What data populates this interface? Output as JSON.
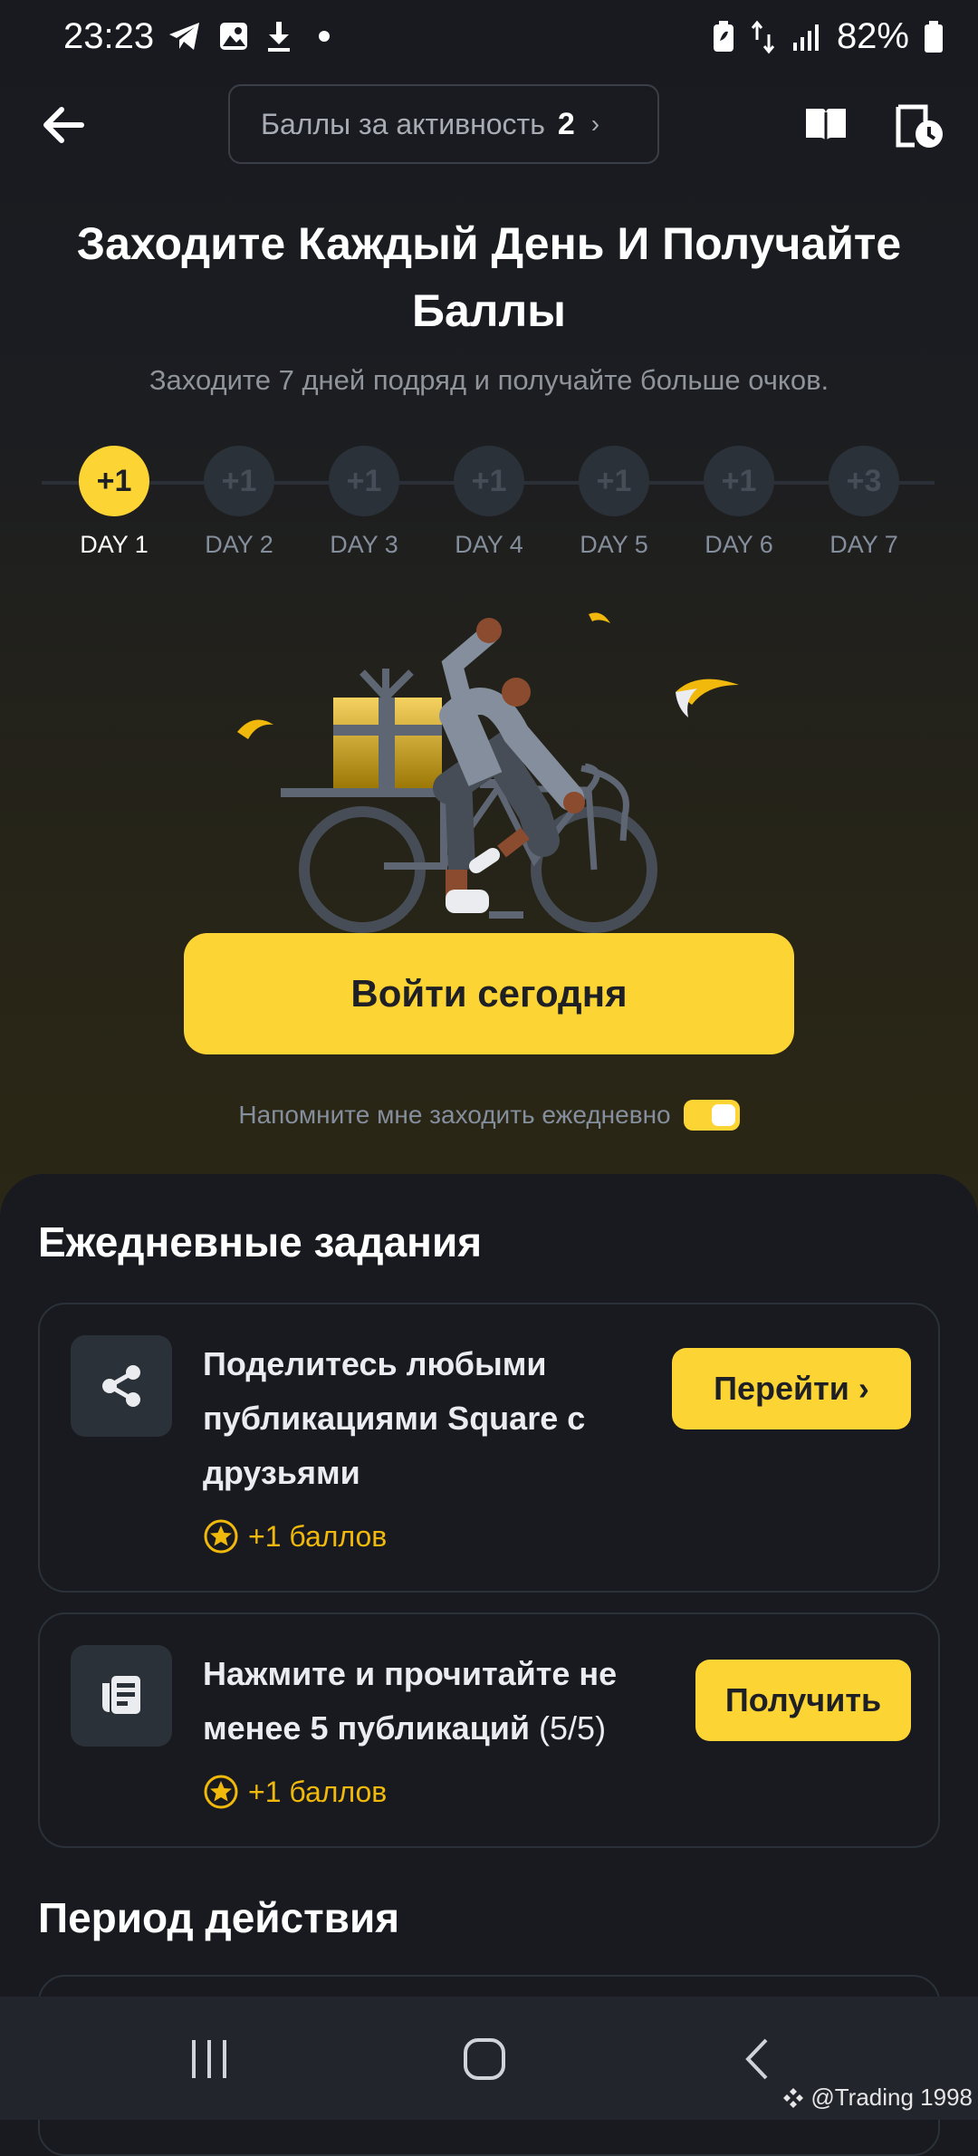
{
  "status_bar": {
    "time": "23:23",
    "battery": "82%",
    "icons": [
      "telegram-icon",
      "image-icon",
      "download-icon",
      "dot-icon",
      "battery-saver-icon",
      "data-arrows-icon",
      "signal-icon",
      "battery-icon"
    ]
  },
  "header": {
    "points_label": "Баллы за активность",
    "points_value": "2",
    "points_chevron": "›"
  },
  "hero": {
    "title": "Заходите Каждый День И Получайте Баллы",
    "subtitle": "Заходите 7 дней подряд и получайте больше очков."
  },
  "days": [
    {
      "reward": "+1",
      "label": "DAY 1",
      "active": true
    },
    {
      "reward": "+1",
      "label": "DAY 2",
      "active": false
    },
    {
      "reward": "+1",
      "label": "DAY 3",
      "active": false
    },
    {
      "reward": "+1",
      "label": "DAY 4",
      "active": false
    },
    {
      "reward": "+1",
      "label": "DAY 5",
      "active": false
    },
    {
      "reward": "+1",
      "label": "DAY 6",
      "active": false
    },
    {
      "reward": "+3",
      "label": "DAY 7",
      "active": false
    }
  ],
  "checkin": {
    "button_label": "Войти сегодня",
    "reminder_text": "Напомните мне заходить ежедневно",
    "reminder_on": true
  },
  "daily_tasks": {
    "title": "Ежедневные задания",
    "tasks": [
      {
        "icon": "share-icon",
        "lines": [
          "Поделитесь любыми",
          "публикациями Square с",
          "друзьями"
        ],
        "reward": "+1 баллов",
        "button": "Перейти",
        "button_chevron": "›"
      },
      {
        "icon": "article-icon",
        "lines": [
          "Нажмите и прочитайте не",
          "менее 5 публикаций"
        ],
        "progress": "(5/5)",
        "reward": "+1 баллов",
        "button": "Получить"
      }
    ]
  },
  "validity": {
    "title": "Период действия"
  },
  "watermark": "@Trading 1998",
  "colors": {
    "accent": "#fcd535",
    "reward": "#f0b90b",
    "background": "#181a20"
  }
}
